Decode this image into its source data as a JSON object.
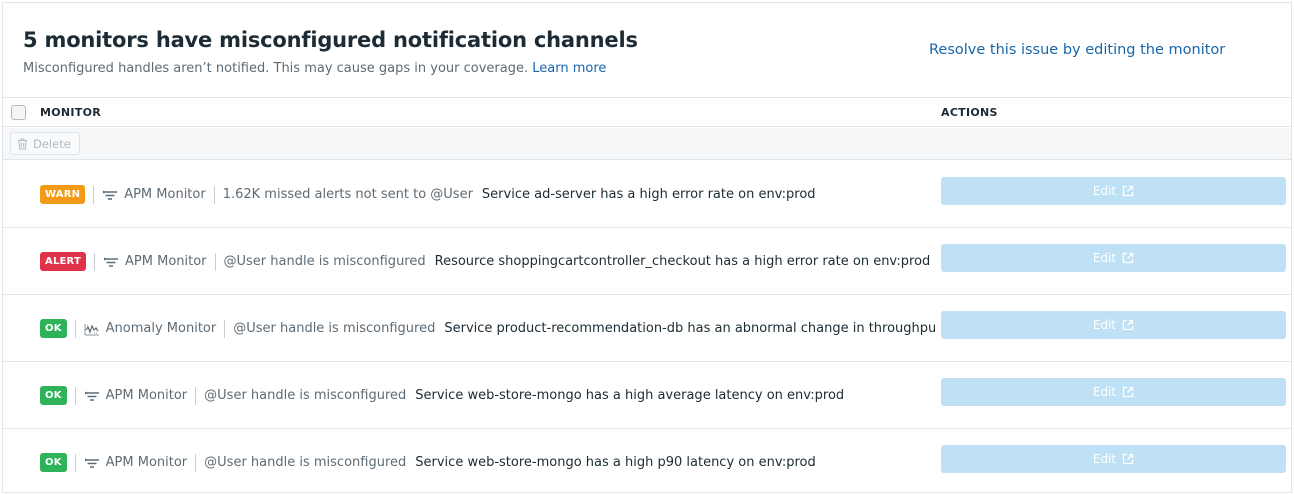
{
  "header": {
    "title": "5 monitors have misconfigured notification channels",
    "subtitle": "Misconfigured handles aren’t notified. This may cause gaps in your coverage.",
    "learn_more": "Learn more",
    "resolve_link": "Resolve this issue by editing the monitor"
  },
  "table": {
    "col_monitor": "MONITOR",
    "col_actions": "ACTIONS",
    "delete_label": "Delete",
    "edit_label": "Edit"
  },
  "rows": [
    {
      "status": "WARN",
      "type": "APM Monitor",
      "type_icon": "apm-filter-icon",
      "issue": "1.62K missed alerts not sent to @User",
      "message": "Service ad-server has a high error rate on env:prod"
    },
    {
      "status": "ALERT",
      "type": "APM Monitor",
      "type_icon": "apm-filter-icon",
      "issue": "@User handle is misconfigured",
      "message": "Resource shoppingcartcontroller_checkout has a high error rate on env:prod"
    },
    {
      "status": "OK",
      "type": "Anomaly Monitor",
      "type_icon": "anomaly-icon",
      "issue": "@User handle is misconfigured",
      "message": "Service product-recommendation-db has an abnormal change in throughput on er"
    },
    {
      "status": "OK",
      "type": "APM Monitor",
      "type_icon": "apm-filter-icon",
      "issue": "@User handle is misconfigured",
      "message": "Service web-store-mongo has a high average latency on env:prod"
    },
    {
      "status": "OK",
      "type": "APM Monitor",
      "type_icon": "apm-filter-icon",
      "issue": "@User handle is misconfigured",
      "message": "Service web-store-mongo has a high p90 latency on env:prod"
    }
  ],
  "colors": {
    "warn": "#f29b16",
    "alert": "#e0334a",
    "ok": "#2fb35a",
    "link": "#1766ab",
    "edit_button": "#bfe1f5"
  }
}
